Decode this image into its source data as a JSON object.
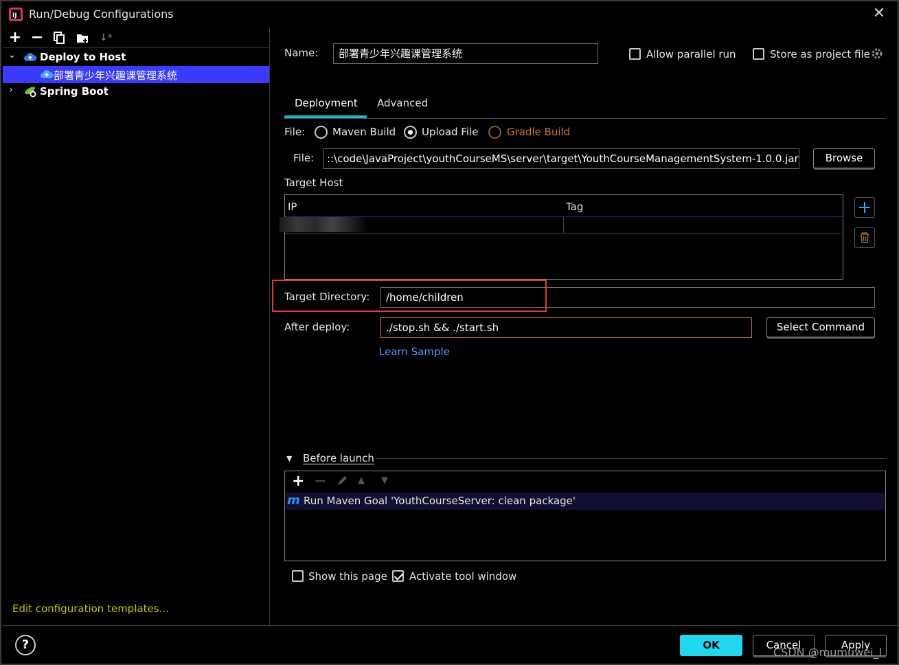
{
  "window": {
    "title": "Run/Debug Configurations"
  },
  "tree": {
    "groups": [
      {
        "label": "Deploy to Host",
        "expanded": true,
        "children": [
          "部署青少年兴趣课管理系统"
        ]
      },
      {
        "label": "Spring Boot",
        "expanded": false
      }
    ],
    "edit_templates_link": "Edit configuration templates..."
  },
  "config": {
    "name_label": "Name:",
    "name_value": "部署青少年兴趣课管理系统",
    "allow_parallel_label": "Allow parallel run",
    "allow_parallel_checked": false,
    "store_project_label": "Store as project file",
    "store_project_checked": false
  },
  "tabs": {
    "items": [
      "Deployment",
      "Advanced"
    ],
    "active": "Deployment"
  },
  "deployment": {
    "file_source_label": "File:",
    "options": [
      "Maven Build",
      "Upload File",
      "Gradle Build"
    ],
    "selected_option": "Upload File",
    "file_label": "File:",
    "file_path": "::\\code\\JavaProject\\youthCourseMS\\server\\target\\YouthCourseManagementSystem-1.0.0.jar",
    "browse_label": "Browse",
    "target_host_label": "Target Host",
    "host_columns": [
      "IP",
      "Tag"
    ],
    "target_dir_label": "Target Directory:",
    "target_dir_value": "/home/children",
    "after_deploy_label": "After deploy:",
    "after_deploy_value": "./stop.sh && ./start.sh",
    "select_command_label": "Select Command",
    "learn_sample_label": "Learn Sample"
  },
  "before_launch": {
    "title": "Before launch",
    "tasks": [
      "Run Maven Goal 'YouthCourseServer: clean package'"
    ],
    "show_page_label": "Show this page",
    "show_page_checked": false,
    "activate_tool_label": "Activate tool window",
    "activate_tool_checked": true
  },
  "footer": {
    "help_label": "?",
    "ok_label": "OK",
    "cancel_label": "Cancel",
    "apply_label": "Apply",
    "watermark": "CSDN @mumuwei_l"
  },
  "colors": {
    "accent": "#1fd8f0",
    "selection": "#3b3bff",
    "link": "#5b9bff",
    "highlight_box": "#e03c3c",
    "disabled_option": "#c87a2a",
    "template_link": "#c8c800"
  }
}
